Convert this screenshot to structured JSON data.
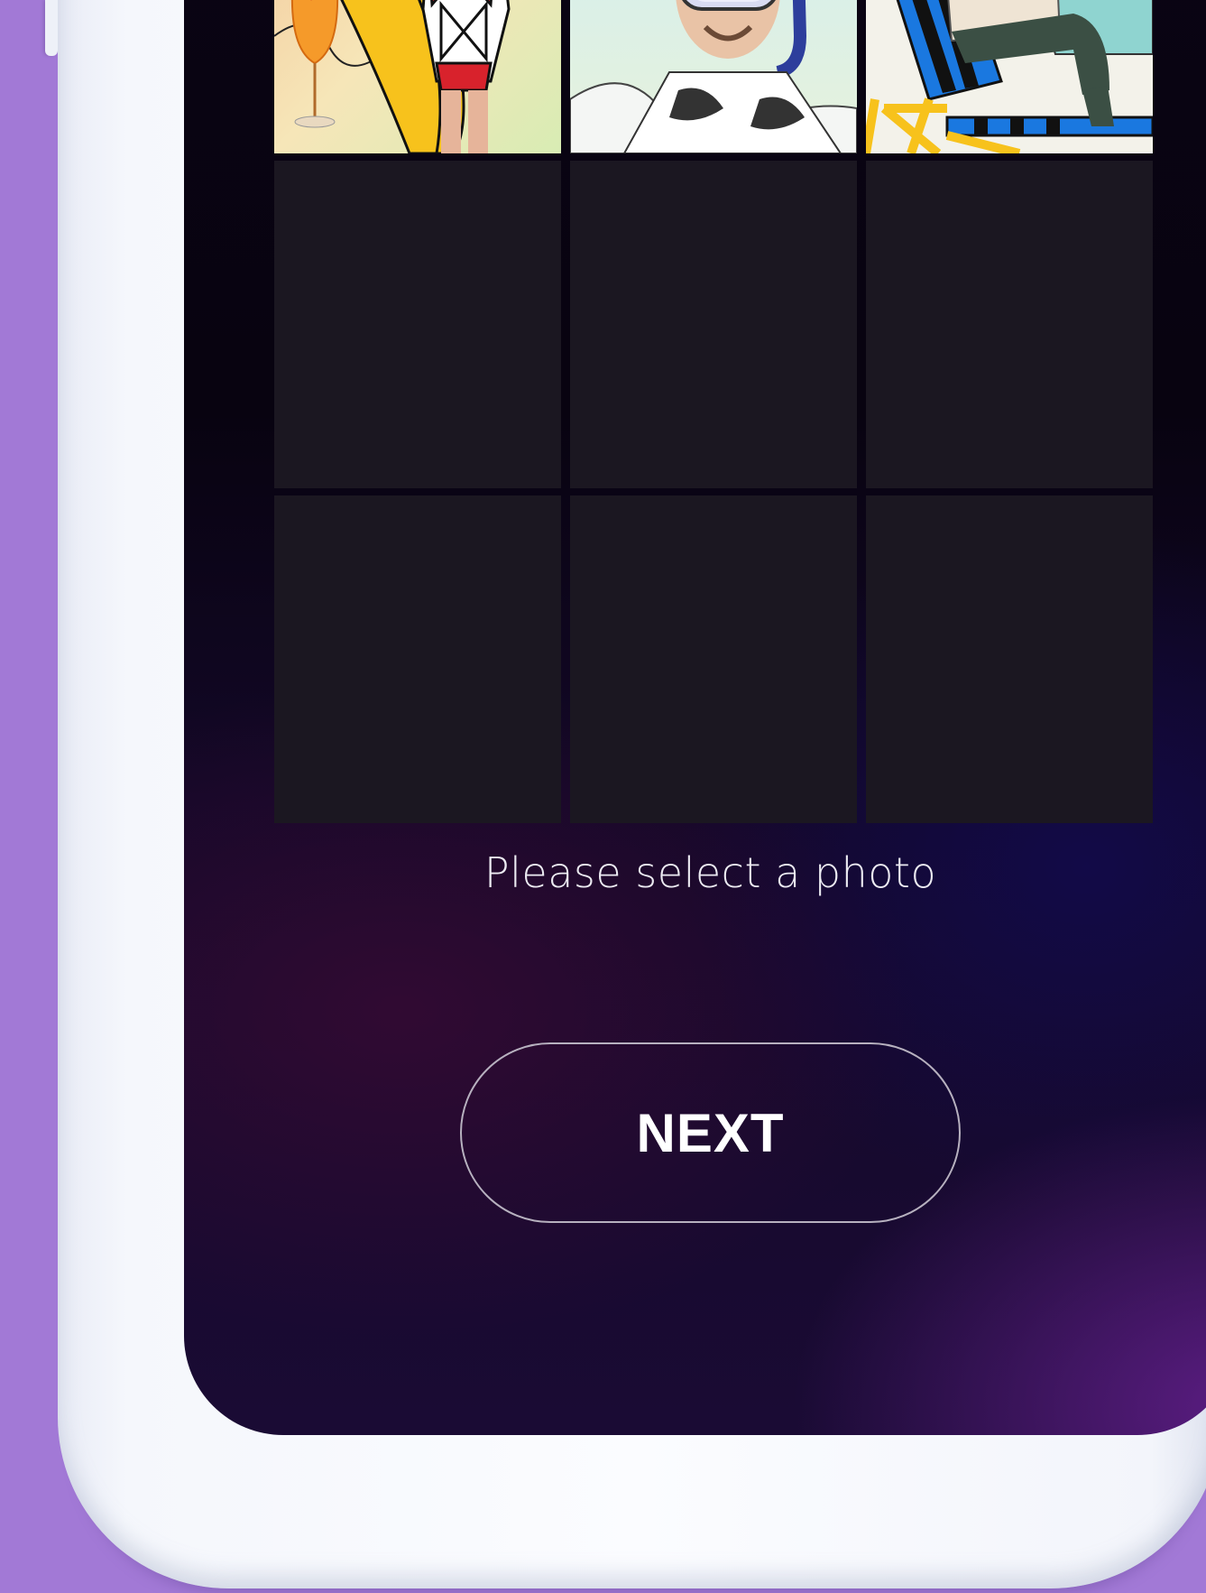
{
  "photo_picker": {
    "prompt": "Please select a photo",
    "next_label": "NEXT",
    "thumbnails": [
      {
        "icon": "surfer-woman-comic-photo"
      },
      {
        "icon": "snorkel-diver-comic-photo"
      },
      {
        "icon": "beach-chair-woman-comic-photo"
      },
      {
        "icon": "empty-slot"
      },
      {
        "icon": "empty-slot"
      },
      {
        "icon": "empty-slot"
      },
      {
        "icon": "empty-slot"
      },
      {
        "icon": "empty-slot"
      },
      {
        "icon": "empty-slot"
      }
    ]
  },
  "colors": {
    "background": "#a279d6",
    "phone_frame": "#f5f7fc",
    "empty_slot": "#1b1721",
    "button_border": "#b7b1bf",
    "text": "#ecebf2"
  }
}
